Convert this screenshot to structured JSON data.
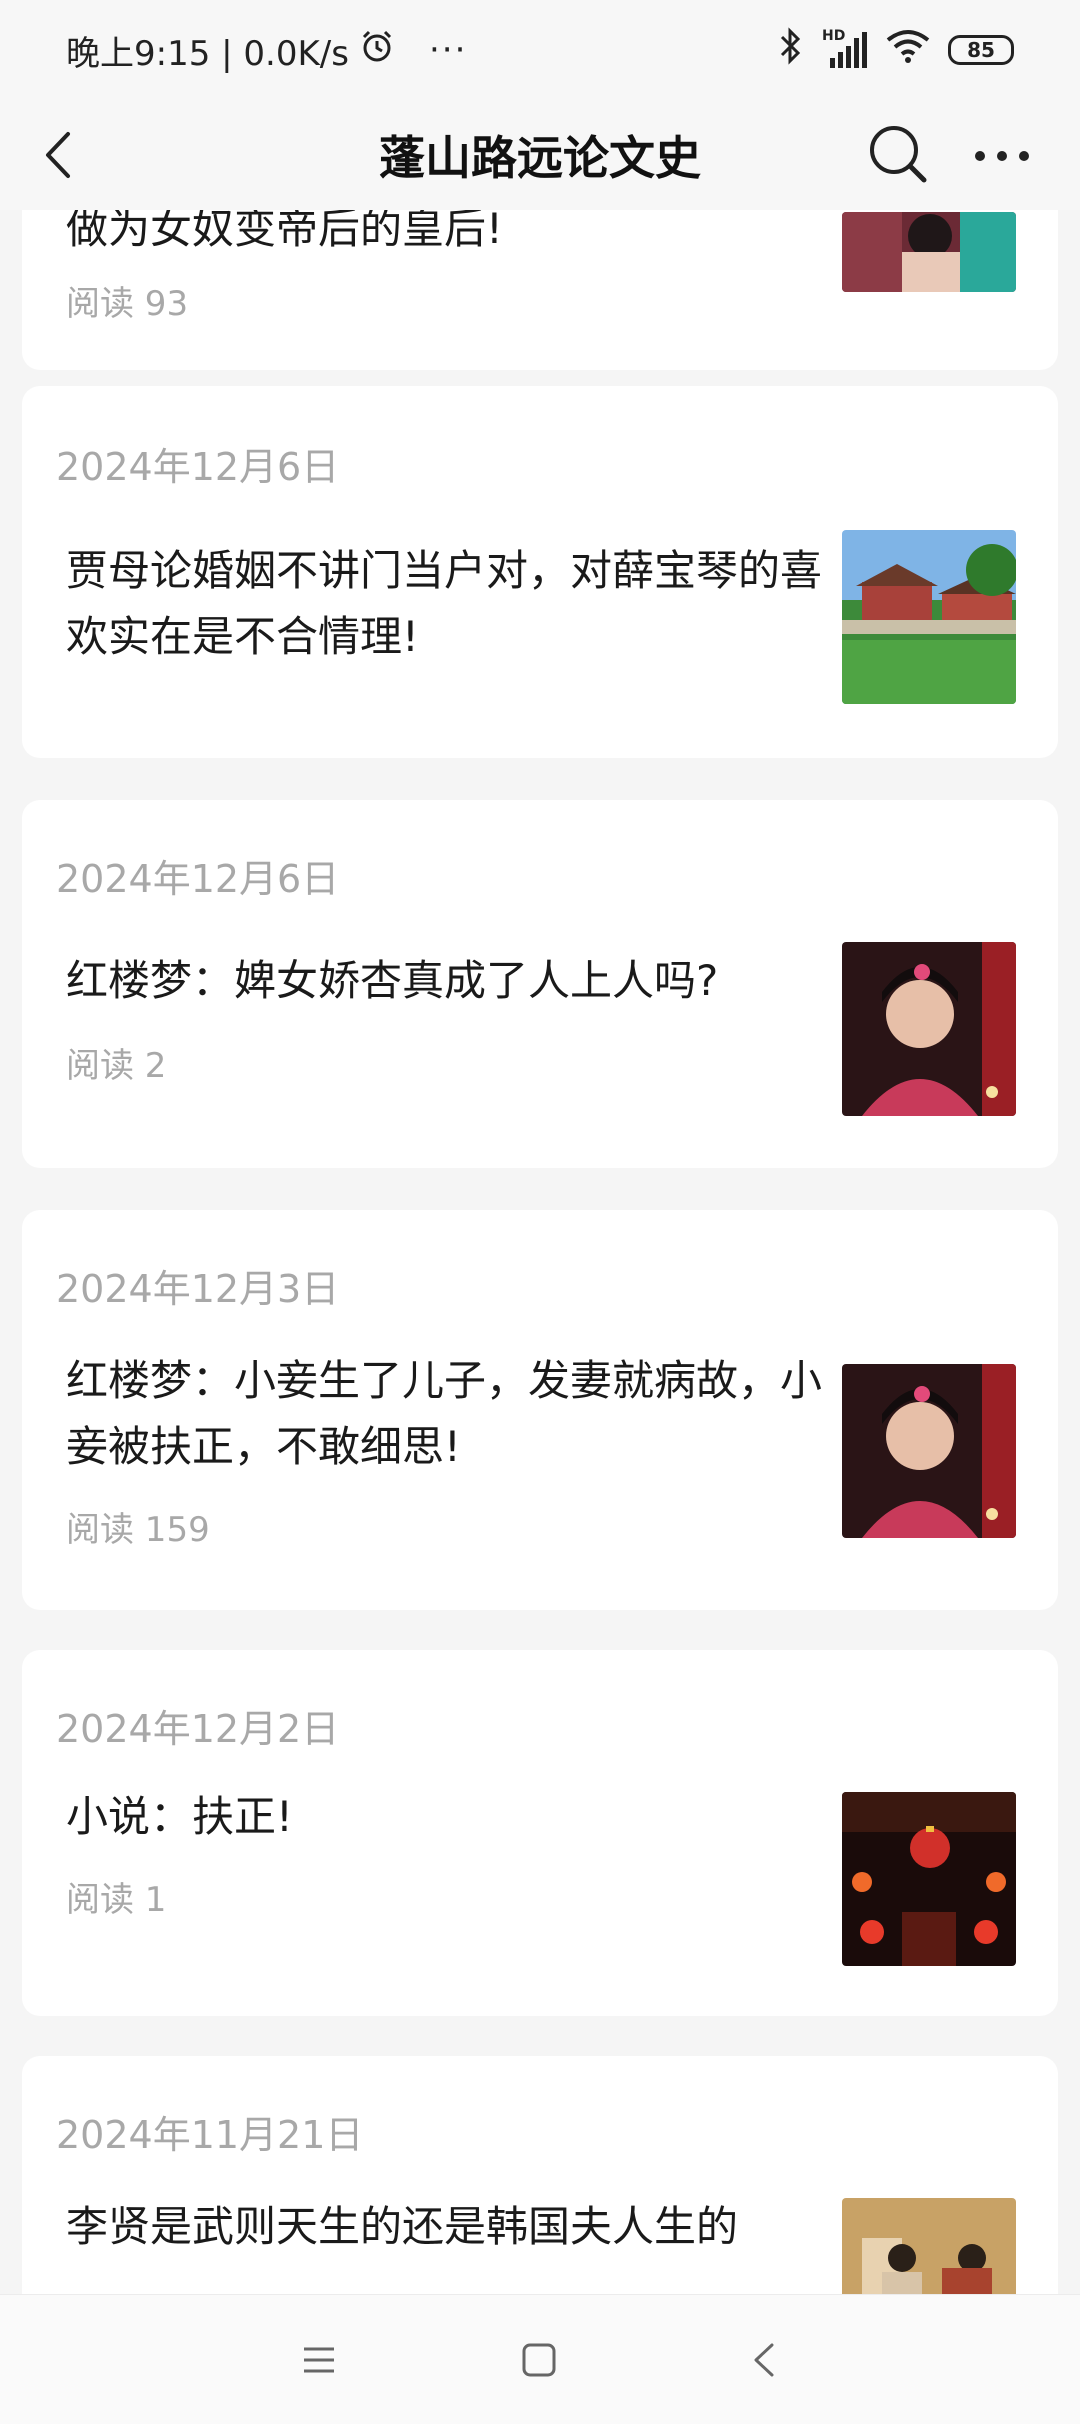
{
  "status_bar": {
    "left_text": "晚上9:15 | 0.0K/s",
    "alarm_icon": "alarm-clock-icon",
    "more_icon": "ellipsis-icon",
    "bluetooth_icon": "bluetooth-icon",
    "signal_label": "HD",
    "wifi_icon": "wifi-icon",
    "battery": "85"
  },
  "nav": {
    "title": "蓬山路远论文史",
    "back_icon": "chevron-left-icon",
    "search_icon": "search-icon",
    "more_icon": "more-icon"
  },
  "articles": [
    {
      "date": "",
      "title": "做为女奴变帝后的皇后!",
      "reads": "阅读 93"
    },
    {
      "date": "2024年12月6日",
      "title": "贾母论婚姻不讲门当户对，对薛宝琴的喜欢实在是不合情理!",
      "reads": ""
    },
    {
      "date": "2024年12月6日",
      "title": "红楼梦：婢女娇杏真成了人上人吗?",
      "reads": "阅读 2"
    },
    {
      "date": "2024年12月3日",
      "title": "红楼梦：小妾生了儿子，发妻就病故，小妾被扶正，不敢细思!",
      "reads": "阅读 159"
    },
    {
      "date": "2024年12月2日",
      "title": "小说：扶正!",
      "reads": "阅读 1"
    },
    {
      "date": "2024年11月21日",
      "title": "李贤是武则天生的还是韩国夫人生的",
      "reads": ""
    }
  ],
  "system_nav": {
    "menu_icon": "menu-icon",
    "home_icon": "home-square-icon",
    "back_icon": "back-triangle-icon"
  },
  "colors": {
    "background": "#f5f5f5",
    "card": "#ffffff",
    "muted_text": "#a8a8a8"
  }
}
